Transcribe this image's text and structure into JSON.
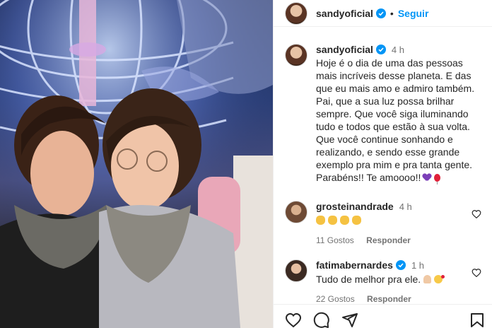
{
  "header": {
    "username": "sandyoficial",
    "separator": "•",
    "follow_label": "Seguir"
  },
  "caption": {
    "username": "sandyoficial",
    "time": "4 h",
    "text": "Hoje é o dia de uma das pessoas mais incríveis desse planeta. E das que eu mais amo e admiro também.\nPai, que a sua luz possa brilhar sempre. Que você siga iluminando tudo e todos que estão à sua volta. Que você continue sonhando e realizando, e sendo esse grande exemplo pra mim e pra tanta gente. Parabéns!! Te amoooo!!"
  },
  "comments": [
    {
      "username": "grosteinandrade",
      "time": "4 h",
      "likes": "11 Gostos",
      "reply_label": "Responder"
    },
    {
      "username": "fatimabernardes",
      "time": "1 h",
      "text": "Tudo de melhor pra ele.",
      "likes": "22 Gostos",
      "reply_label": "Responder"
    }
  ],
  "icons": {
    "verified": "verified-badge-icon",
    "like": "heart-icon",
    "comment": "comment-icon",
    "share": "share-icon",
    "save": "bookmark-icon"
  },
  "colors": {
    "link_blue": "#0095f6",
    "verified_blue": "#0095f6",
    "text": "#262626",
    "muted": "#737373",
    "border": "#efefef"
  }
}
